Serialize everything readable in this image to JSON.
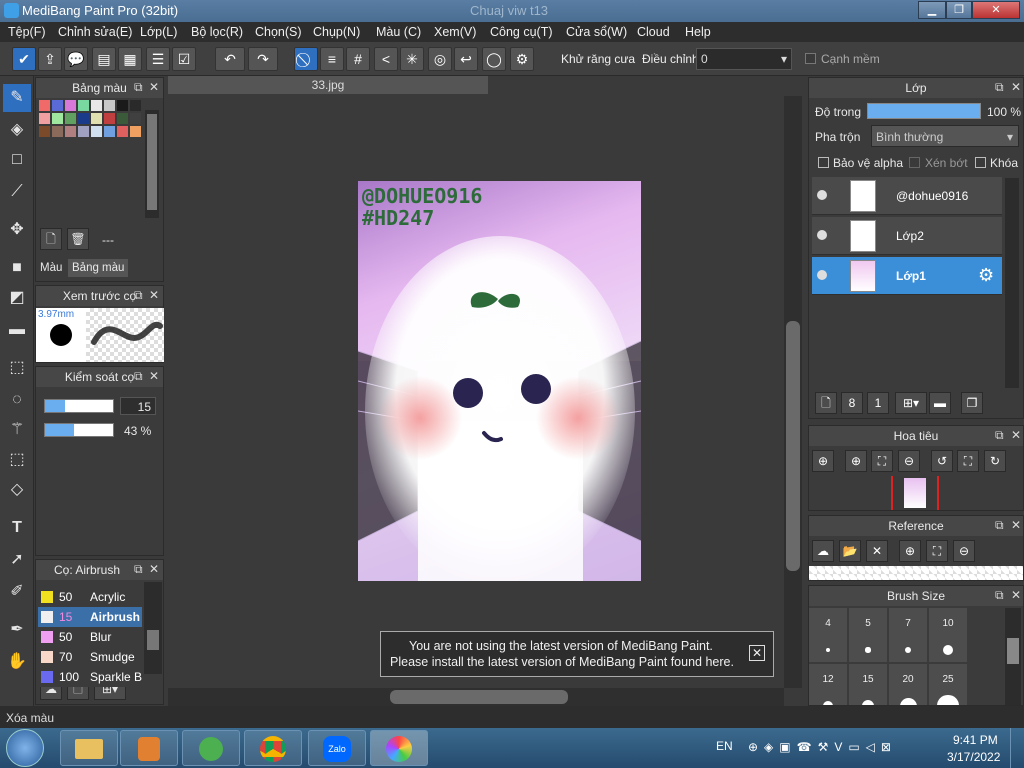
{
  "window": {
    "title": "MediBang Paint Pro (32bit)",
    "ghost_title": "Chuaj viw t13"
  },
  "menu": [
    "Tệp(F)",
    "Chỉnh sửa(E)",
    "Lớp(L)",
    "Bộ lọc(R)",
    "Chọn(S)",
    "Chụp(N)",
    "Màu (C)",
    "Xem(V)",
    "Công cụ(T)",
    "Cửa sổ(W)",
    "Cloud",
    "Help"
  ],
  "toolbar": {
    "antialias_label": "Khử răng cưa",
    "adjust_label": "Điều chỉnh",
    "adjust_value": "0",
    "soft_edge_label": "Cạnh mềm"
  },
  "color_panel": {
    "title": "Bảng màu",
    "dash": "---",
    "tab_color": "Màu",
    "tab_palette": "Bảng màu",
    "swatches": [
      "#f06a6a",
      "#5a6ad6",
      "#d878d8",
      "#78d8a0",
      "#e8e8e8",
      "#c8c8c8",
      "#1a1a1a",
      "#2a2a2a",
      "#f0a0a0",
      "#a0e8a0",
      "#60a060",
      "#1a3a8a",
      "#e0e0b0",
      "#c04040",
      "#3a5a3a",
      "#404040",
      "#7a4a2a",
      "#8a6a5a",
      "#b08080",
      "#a0a0c0",
      "#d0e0f0",
      "#70a0e0",
      "#e06060",
      "#f0a060"
    ]
  },
  "preview_panel": {
    "title": "Xem trước cọ",
    "size": "3.97mm"
  },
  "brush_control": {
    "title": "Kiểm soát cọ",
    "size_value": "15",
    "opacity_value": "43 %",
    "size_fraction": 0.3,
    "opacity_fraction": 0.43
  },
  "brush_list": {
    "title": "Cọ: Airbrush",
    "items": [
      {
        "size": "50",
        "name": "Acrylic",
        "color": "#f0e020",
        "selected": false
      },
      {
        "size": "15",
        "name": "Airbrush",
        "color": "#f0f0f0",
        "selected": true
      },
      {
        "size": "50",
        "name": "Blur",
        "color": "#f0a0f0",
        "selected": false
      },
      {
        "size": "70",
        "name": "Smudge",
        "color": "#f8d8c8",
        "selected": false
      },
      {
        "size": "100",
        "name": "Sparkle Brush",
        "color": "#6a6af0",
        "selected": false
      }
    ]
  },
  "canvas": {
    "tab_title": "33.jpg",
    "watermark_1": "@DOHUEO916",
    "watermark_2": "#HD247"
  },
  "notification": {
    "line1": "You are not using the latest version of MediBang Paint.",
    "line2": "Please install the latest version of MediBang Paint found here."
  },
  "layer_panel": {
    "title": "Lớp",
    "opacity_label": "Độ trong",
    "opacity_value": "100 %",
    "opacity_fraction": 1.0,
    "blend_label": "Pha trộn",
    "blend_value": "Bình thường",
    "protect_alpha": "Bảo vệ alpha",
    "clip": "Xén bớt",
    "lock": "Khóa",
    "layers": [
      {
        "name": "@dohue0916",
        "selected": false
      },
      {
        "name": "Lớp2",
        "selected": false
      },
      {
        "name": "Lớp1",
        "selected": true
      }
    ]
  },
  "navigator_panel": {
    "title": "Hoa tiêu"
  },
  "reference_panel": {
    "title": "Reference"
  },
  "brush_size_panel": {
    "title": "Brush Size",
    "sizes": [
      "4",
      "5",
      "7",
      "10",
      "12",
      "15",
      "20",
      "25"
    ]
  },
  "status": {
    "text": "Xóa màu"
  },
  "taskbar": {
    "lang": "EN",
    "time": "9:41 PM",
    "date": "3/17/2022",
    "apps": [
      "explorer",
      "media-player",
      "coccoc",
      "chrome",
      "zalo",
      "paint"
    ]
  }
}
